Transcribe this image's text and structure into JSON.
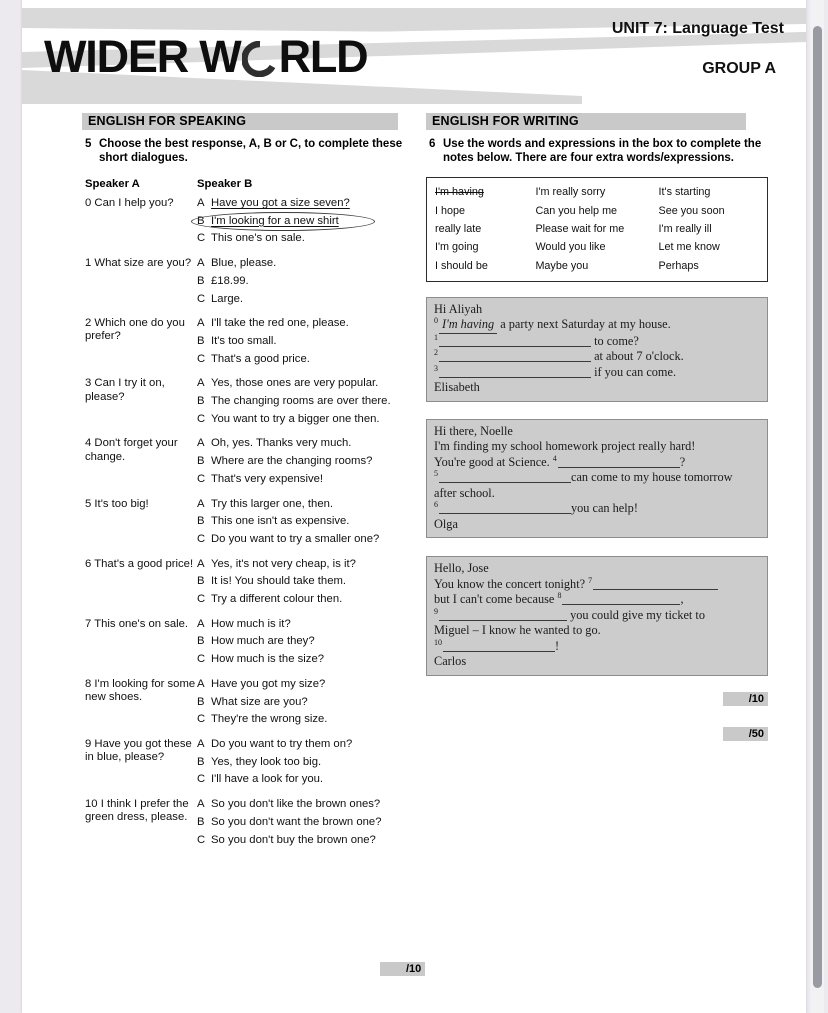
{
  "header": {
    "logo_text_1": "WIDER W",
    "logo_text_2": "RLD",
    "logo_ring_icon": "open-ring-letter-o",
    "unit_title": "UNIT 7: Language Test",
    "group_title": "GROUP A"
  },
  "speaking": {
    "section_title": "ENGLISH FOR SPEAKING",
    "exercise_number": "5",
    "instruction": "Choose the best response, A, B or C, to complete these short dialogues.",
    "col_a_header": "Speaker A",
    "col_b_header": "Speaker B",
    "score": "/10",
    "rows": [
      {
        "prompt": "0 Can I help you?",
        "options": [
          {
            "letter": "A",
            "text": "Have you got a size seven?",
            "style": "underlined"
          },
          {
            "letter": "B",
            "text": "I'm looking for a new shirt",
            "style": "circled"
          },
          {
            "letter": "C",
            "text": "This one's on sale.",
            "style": "plain"
          }
        ]
      },
      {
        "prompt": "1 What size are you?",
        "options": [
          {
            "letter": "A",
            "text": "Blue, please.",
            "style": "plain"
          },
          {
            "letter": "B",
            "text": "£18.99.",
            "style": "plain"
          },
          {
            "letter": "C",
            "text": "Large.",
            "style": "plain"
          }
        ]
      },
      {
        "prompt": "2 Which one do you prefer?",
        "options": [
          {
            "letter": "A",
            "text": "I'll take the red one, please.",
            "style": "plain"
          },
          {
            "letter": "B",
            "text": "It's too small.",
            "style": "plain"
          },
          {
            "letter": "C",
            "text": "That's a good price.",
            "style": "plain"
          }
        ]
      },
      {
        "prompt": "3 Can I try it on, please?",
        "options": [
          {
            "letter": "A",
            "text": "Yes, those ones are very popular.",
            "style": "plain"
          },
          {
            "letter": "B",
            "text": "The changing rooms are over there.",
            "style": "plain"
          },
          {
            "letter": "C",
            "text": "You want to try a bigger one then.",
            "style": "plain"
          }
        ]
      },
      {
        "prompt": "4 Don't forget your change.",
        "options": [
          {
            "letter": "A",
            "text": "Oh, yes. Thanks very much.",
            "style": "plain"
          },
          {
            "letter": "B",
            "text": "Where are the changing rooms?",
            "style": "plain"
          },
          {
            "letter": "C",
            "text": "That's very expensive!",
            "style": "plain"
          }
        ]
      },
      {
        "prompt": "5 It's too big!",
        "options": [
          {
            "letter": "A",
            "text": "Try this larger one, then.",
            "style": "plain"
          },
          {
            "letter": "B",
            "text": "This one isn't as expensive.",
            "style": "plain"
          },
          {
            "letter": "C",
            "text": "Do you want to try a smaller one?",
            "style": "plain"
          }
        ]
      },
      {
        "prompt": "6 That's a good price!",
        "options": [
          {
            "letter": "A",
            "text": "Yes, it's not very cheap, is it?",
            "style": "plain"
          },
          {
            "letter": "B",
            "text": "It is! You should take them.",
            "style": "plain"
          },
          {
            "letter": "C",
            "text": "Try a different colour then.",
            "style": "plain"
          }
        ]
      },
      {
        "prompt": "7 This one's on sale.",
        "options": [
          {
            "letter": "A",
            "text": "How much is it?",
            "style": "plain"
          },
          {
            "letter": "B",
            "text": "How much are they?",
            "style": "plain"
          },
          {
            "letter": "C",
            "text": "How much is the size?",
            "style": "plain"
          }
        ]
      },
      {
        "prompt": "8 I'm looking for some new shoes.",
        "options": [
          {
            "letter": "A",
            "text": "Have you got my size?",
            "style": "plain"
          },
          {
            "letter": "B",
            "text": "What size are you?",
            "style": "plain"
          },
          {
            "letter": "C",
            "text": "They're the wrong size.",
            "style": "plain"
          }
        ]
      },
      {
        "prompt": "9 Have you got these in blue, please?",
        "options": [
          {
            "letter": "A",
            "text": "Do you want to try them on?",
            "style": "plain"
          },
          {
            "letter": "B",
            "text": "Yes, they look too big.",
            "style": "plain"
          },
          {
            "letter": "C",
            "text": "I'll have a look for you.",
            "style": "plain"
          }
        ]
      },
      {
        "prompt": "10 I think I prefer the green dress, please.",
        "options": [
          {
            "letter": "A",
            "text": "So you don't like the brown ones?",
            "style": "plain"
          },
          {
            "letter": "B",
            "text": "So you don't want the brown one?",
            "style": "plain"
          },
          {
            "letter": "C",
            "text": "So you don't buy the brown one?",
            "style": "plain"
          }
        ]
      }
    ]
  },
  "writing": {
    "section_title": "ENGLISH FOR WRITING",
    "exercise_number": "6",
    "instruction": "Use the words and expressions in the box to complete the notes below. There are four extra words/expressions.",
    "wordbox": [
      [
        {
          "text": "I'm having",
          "struck": true
        },
        {
          "text": "I'm really sorry",
          "struck": false
        },
        {
          "text": "It's starting",
          "struck": false
        }
      ],
      [
        {
          "text": "I hope",
          "struck": false
        },
        {
          "text": "Can you help me",
          "struck": false
        },
        {
          "text": "See you soon",
          "struck": false
        }
      ],
      [
        {
          "text": "really late",
          "struck": false
        },
        {
          "text": "Please wait for me",
          "struck": false
        },
        {
          "text": "I'm really ill",
          "struck": false
        }
      ],
      [
        {
          "text": "I'm going",
          "struck": false
        },
        {
          "text": "Would you like",
          "struck": false
        },
        {
          "text": "Let me know",
          "struck": false
        }
      ],
      [
        {
          "text": "I should be",
          "struck": false
        },
        {
          "text": "Maybe you",
          "struck": false
        },
        {
          "text": "Perhaps",
          "struck": false
        }
      ]
    ],
    "note1": {
      "greeting": "Hi Aliyah",
      "l1_num": "0",
      "l1_answer": "I'm having",
      "l1_after": "a party next Saturday at my house.",
      "l2_num": "1",
      "l2_after": "to come?",
      "l3_num": "2",
      "l3_after": "at about 7 o'clock.",
      "l4_num": "3",
      "l4_after": "if you can come.",
      "signature": "Elisabeth"
    },
    "note2": {
      "greeting": "Hi there, Noelle",
      "line1": "I'm finding my school homework project really hard!",
      "line2_before": "You're good at Science.",
      "line2_num": "4",
      "line2_after": "?",
      "line3_num": "5",
      "line3_after": "can come to my house tomorrow",
      "line4": "after school.",
      "line5_num": "6",
      "line5_after": "you can help!",
      "signature": "Olga"
    },
    "note3": {
      "greeting": "Hello, Jose",
      "line1_before": "You know the concert tonight?",
      "line1_num": "7",
      "line2_before": "but I can't come because",
      "line2_num": "8",
      "line2_after": ",",
      "line3_num": "9",
      "line3_after": "you could give my ticket to",
      "line4": "Miguel – I know he wanted to go.",
      "line5_num": "10",
      "line5_after": "!",
      "signature": "Carlos"
    },
    "score_exercise": "/10",
    "score_total": "/50"
  }
}
